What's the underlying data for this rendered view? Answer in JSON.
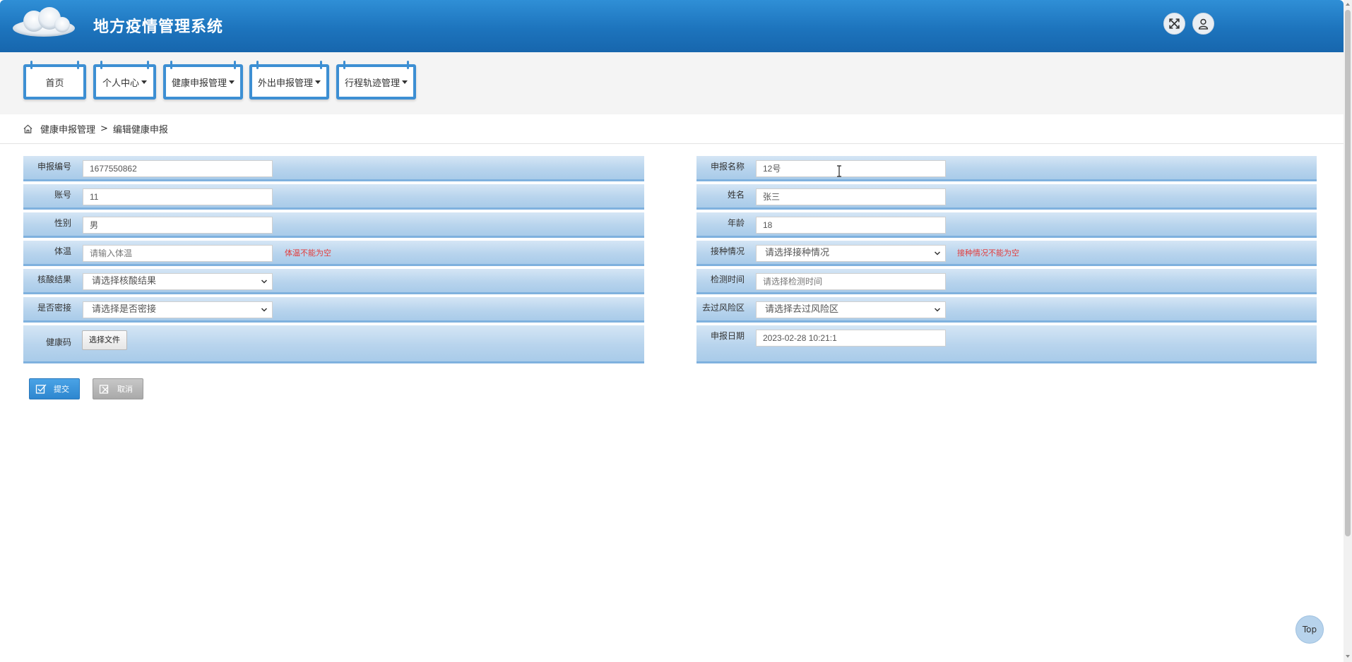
{
  "header": {
    "title": "地方疫情管理系统",
    "fullscreen_icon": "expand-icon",
    "user_icon": "user-icon"
  },
  "nav": {
    "items": [
      {
        "label": "首页",
        "has_dropdown": false
      },
      {
        "label": "个人中心",
        "has_dropdown": true
      },
      {
        "label": "健康申报管理",
        "has_dropdown": true
      },
      {
        "label": "外出申报管理",
        "has_dropdown": true
      },
      {
        "label": "行程轨迹管理",
        "has_dropdown": true
      }
    ]
  },
  "breadcrumb": {
    "home_icon": "home-icon",
    "parent": "健康申报管理",
    "separator": ">",
    "current": "编辑健康申报"
  },
  "form": {
    "left": {
      "report_no": {
        "label": "申报编号",
        "value": "1677550862"
      },
      "account": {
        "label": "账号",
        "value": "11"
      },
      "gender": {
        "label": "性别",
        "value": "男"
      },
      "temperature": {
        "label": "体温",
        "placeholder": "请输入体温",
        "error": "体温不能为空"
      },
      "nucleic_result": {
        "label": "核酸结果",
        "selected": "请选择核酸结果"
      },
      "close_contact": {
        "label": "是否密接",
        "selected": "请选择是否密接"
      },
      "health_code": {
        "label": "健康码",
        "button": "选择文件"
      }
    },
    "right": {
      "report_name": {
        "label": "申报名称",
        "value": "12号"
      },
      "name": {
        "label": "姓名",
        "value": "张三"
      },
      "age": {
        "label": "年龄",
        "value": "18"
      },
      "vaccination": {
        "label": "接种情况",
        "selected": "请选择接种情况",
        "error": "接种情况不能为空"
      },
      "test_time": {
        "label": "检测时间",
        "placeholder": "请选择检测时间"
      },
      "risk_area": {
        "label": "去过风险区",
        "selected": "请选择去过风险区"
      },
      "report_date": {
        "label": "申报日期",
        "value": "2023-02-28 10:21:1"
      }
    }
  },
  "actions": {
    "submit": "提交",
    "cancel": "取消"
  },
  "top_button": "Top",
  "colors": {
    "header_blue": "#1d74bd",
    "row_blue": "#b8d4ed",
    "error_red": "#e23b3b",
    "submit_blue": "#2e86cf"
  }
}
